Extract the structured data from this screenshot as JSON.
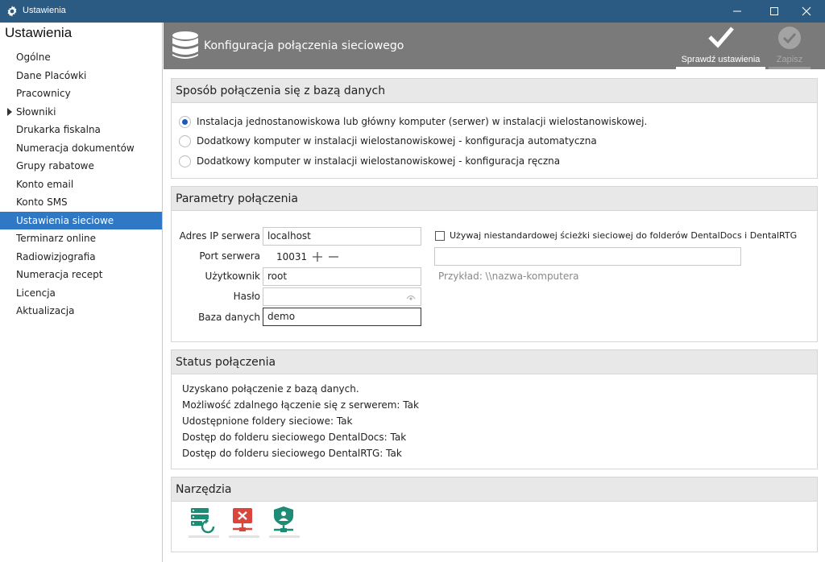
{
  "window": {
    "title": "Ustawienia",
    "icons": {
      "app": "gear-icon",
      "minimize": "minimize-icon",
      "maximize": "maximize-icon",
      "close": "close-icon"
    }
  },
  "sidebar": {
    "heading": "Ustawienia",
    "items": [
      {
        "label": "Ogólne"
      },
      {
        "label": "Dane Placówki"
      },
      {
        "label": "Pracownicy"
      },
      {
        "label": "Słowniki"
      },
      {
        "label": "Drukarka fiskalna"
      },
      {
        "label": "Numeracja dokumentów"
      },
      {
        "label": "Grupy rabatowe"
      },
      {
        "label": "Konto email"
      },
      {
        "label": "Konto SMS"
      },
      {
        "label": "Ustawienia sieciowe"
      },
      {
        "label": "Terminarz online"
      },
      {
        "label": "Radiowizjografia"
      },
      {
        "label": "Numeracja recept"
      },
      {
        "label": "Licencja"
      },
      {
        "label": "Aktualizacja"
      }
    ]
  },
  "header": {
    "title": "Konfiguracja połączenia sieciowego",
    "check_label": "Sprawdź ustawienia",
    "save_label": "Zapisz"
  },
  "connection_mode": {
    "title": "Sposób połączenia się z bazą danych",
    "options": [
      {
        "label": "Instalacja jednostanowiskowa lub główny komputer (serwer) w instalacji wielostanowiskowej.",
        "selected": true
      },
      {
        "label": "Dodatkowy komputer w instalacji wielostanowiskowej - konfiguracja automatyczna",
        "selected": false
      },
      {
        "label": "Dodatkowy komputer w instalacji wielostanowiskowej - konfiguracja ręczna",
        "selected": false
      }
    ]
  },
  "params": {
    "title": "Parametry połączenia",
    "server_label": "Adres IP serwera",
    "server_value": "localhost",
    "port_label": "Port serwera",
    "port_value": "10031",
    "user_label": "Użytkownik",
    "user_value": "root",
    "password_label": "Hasło",
    "password_value": "",
    "db_label": "Baza danych",
    "db_value": "demo",
    "custom_path_label": "Używaj niestandardowej ścieżki sieciowej do folderów DentalDocs i DentalRTG",
    "custom_path_value": "",
    "example": "Przykład: \\\\nazwa-komputera"
  },
  "status": {
    "title": "Status połączenia",
    "lines": [
      "Uzyskano połączenie z bazą danych.",
      "Możliwość zdalnego łączenie się z serwerem: Tak",
      "Udostępnione foldery sieciowe: Tak",
      "Dostęp do folderu sieciowego DentalDocs: Tak",
      "Dostęp do folderu sieciowego DentalRTG: Tak"
    ]
  },
  "tools": {
    "title": "Narzędzia",
    "icons": [
      "server-restore-icon",
      "network-disconnect-icon",
      "network-shield-icon"
    ]
  },
  "colors": {
    "titlebar": "#2b5a82",
    "header": "#7a7a7a",
    "accent": "#2e78c6",
    "radio": "#1f58b6",
    "tool_green": "#1e8b74",
    "tool_red": "#d9463b"
  }
}
